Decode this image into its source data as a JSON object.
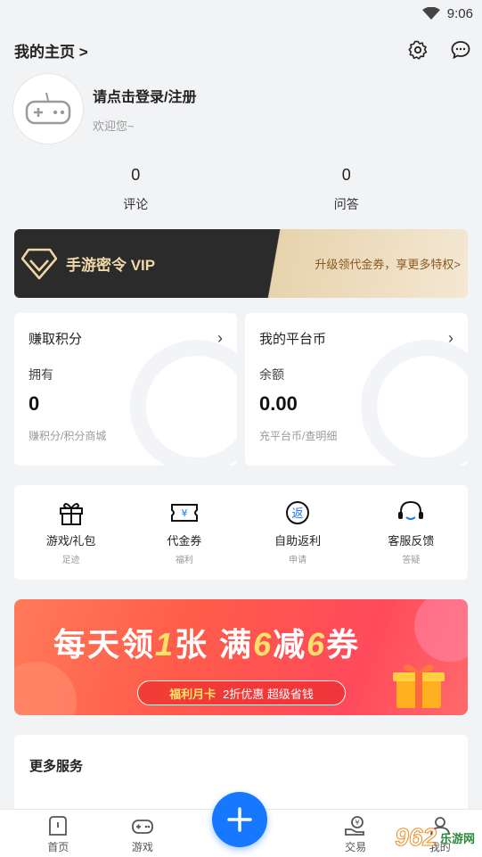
{
  "status_bar": {
    "time": "9:06"
  },
  "header": {
    "home_link": "我的主页 >"
  },
  "profile": {
    "login_prompt": "请点击登录/注册",
    "welcome": "欢迎您~"
  },
  "stats": [
    {
      "value": "0",
      "label": "评论"
    },
    {
      "value": "0",
      "label": "问答"
    }
  ],
  "vip": {
    "title": "手游密令 VIP",
    "desc": "升级领代金券，享更多特权>"
  },
  "cards": {
    "points": {
      "title": "赚取积分",
      "sub": "拥有",
      "value": "0",
      "footer": "赚积分/积分商城"
    },
    "coins": {
      "title": "我的平台币",
      "sub": "余额",
      "value": "0.00",
      "footer": "充平台币/查明细"
    }
  },
  "quick_actions": [
    {
      "label": "游戏/礼包",
      "sub": "足迹",
      "icon": "gift-icon"
    },
    {
      "label": "代金券",
      "sub": "福利",
      "icon": "voucher-icon"
    },
    {
      "label": "自助返利",
      "sub": "申请",
      "icon": "rebate-icon"
    },
    {
      "label": "客服反馈",
      "sub": "答疑",
      "icon": "headset-icon"
    }
  ],
  "banner": {
    "headline_a": "每天领",
    "headline_num1": "1",
    "headline_b": "张 满",
    "headline_num2": "6",
    "headline_c": "减",
    "headline_num3": "6",
    "headline_d": "券",
    "pill_tag": "福利月卡",
    "pill_text": "2折优惠 超级省钱"
  },
  "more_services": {
    "title": "更多服务"
  },
  "tabbar": {
    "home": "首页",
    "games": "游戏",
    "trade": "交易",
    "mine": "我的"
  },
  "watermark": {
    "number": "962",
    "text": "乐游网"
  },
  "colors": {
    "accent": "#1677ff",
    "vip_gold": "#f0d8a8",
    "banner_red": "#ff5a4a"
  }
}
